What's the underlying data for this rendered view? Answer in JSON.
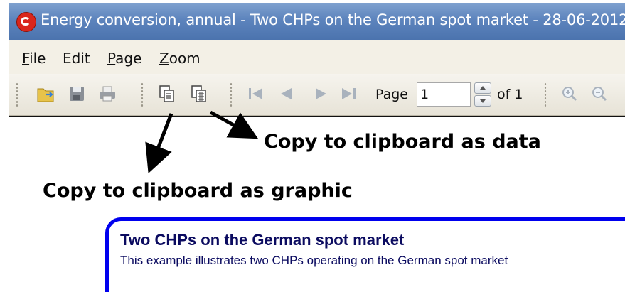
{
  "window": {
    "title": "Energy conversion, annual - Two CHPs on the German spot market - 28-06-2012"
  },
  "menubar": {
    "items": [
      {
        "accel": "F",
        "rest": "ile"
      },
      {
        "accel": "",
        "rest": "Edit"
      },
      {
        "accel": "P",
        "rest": "age"
      },
      {
        "accel": "Z",
        "rest": "oom"
      }
    ]
  },
  "toolbar": {
    "page_label": "Page",
    "page_value": "1",
    "of_label": "of 1"
  },
  "annotations": {
    "copy_data": "Copy to clipboard as data",
    "copy_graphic": "Copy to clipboard as graphic"
  },
  "report": {
    "title": "Two CHPs on the German spot market",
    "description": "This example illustrates two CHPs operating on the German spot market"
  },
  "icons": {
    "app": "app-logo-icon",
    "open": "open-folder-icon",
    "save": "save-icon",
    "print": "print-icon",
    "copy_graphic": "copy-graphic-icon",
    "copy_data": "copy-data-icon",
    "first": "first-page-icon",
    "prev": "previous-page-icon",
    "next": "next-page-icon",
    "last": "last-page-icon",
    "zoom_in": "zoom-in-icon",
    "zoom_out": "zoom-out-icon"
  },
  "colors": {
    "titlebar": "#5d84bd",
    "report_border": "#0000ee",
    "app_icon": "#d9261c"
  }
}
